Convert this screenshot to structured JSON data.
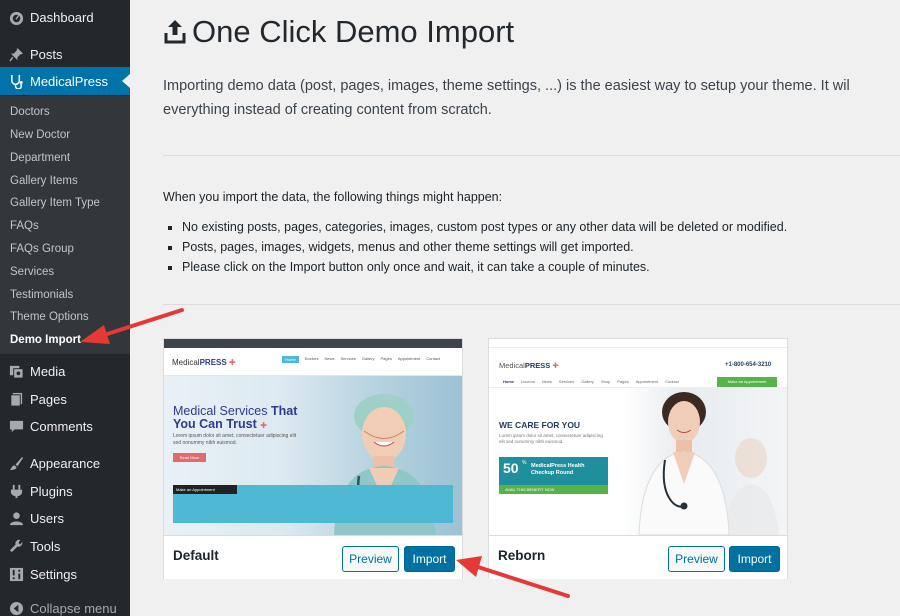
{
  "sidebar": {
    "top_items": [
      {
        "label": "Dashboard",
        "icon": "dashboard-icon"
      },
      {
        "label": "Posts",
        "icon": "pin-icon"
      },
      {
        "label": "MedicalPress",
        "icon": "stethoscope-icon"
      }
    ],
    "submenu": [
      "Doctors",
      "New Doctor",
      "Department",
      "Gallery Items",
      "Gallery Item Type",
      "FAQs",
      "FAQs Group",
      "Services",
      "Testimonials",
      "Theme Options",
      "Demo Import"
    ],
    "bottom_items": [
      {
        "label": "Media",
        "icon": "media-icon"
      },
      {
        "label": "Pages",
        "icon": "pages-icon"
      },
      {
        "label": "Comments",
        "icon": "comment-icon"
      },
      {
        "label": "Appearance",
        "icon": "brush-icon"
      },
      {
        "label": "Plugins",
        "icon": "plugin-icon"
      },
      {
        "label": "Users",
        "icon": "user-icon"
      },
      {
        "label": "Tools",
        "icon": "wrench-icon"
      },
      {
        "label": "Settings",
        "icon": "settings-icon"
      },
      {
        "label": "Collapse menu",
        "icon": "collapse-icon"
      }
    ]
  },
  "page": {
    "title": "One Click Demo Import",
    "intro_line1": "Importing demo data (post, pages, images, theme settings, ...) is the easiest way to setup your theme. It wil",
    "intro_line2": "everything instead of creating content from scratch.",
    "lead": "When you import the data, the following things might happen:",
    "bullets": [
      "No existing posts, pages, categories, images, custom post types or any other data will be deleted or modified.",
      "Posts, pages, images, widgets, menus and other theme settings will get imported.",
      "Please click on the Import button only once and wait, it can take a couple of minutes."
    ]
  },
  "demos": [
    {
      "name": "Default",
      "preview_label": "Preview",
      "import_label": "Import",
      "thumb": {
        "logo_plain": "Medical",
        "logo_bold": "PRESS",
        "headline_1": "Medical Services",
        "headline_2": "That",
        "headline_3": "You Can Trust",
        "subtext": "Lorem ipsum dolor sit amet, consectetuer adipiscing elit sed nonummy nibh euismod.",
        "read_more": "Read More",
        "form_title": "Make an Appointment",
        "nav": [
          "Home",
          "Doctors",
          "News",
          "Services",
          "Gallery",
          "Pages",
          "Appointment",
          "Contact"
        ]
      }
    },
    {
      "name": "Reborn",
      "preview_label": "Preview",
      "import_label": "Import",
      "thumb": {
        "logo_plain": "Medical",
        "logo_bold": "PRESS",
        "headline": "WE CARE FOR YOU",
        "subtext": "Lorem ipsum dolor sit amet, consectetuer adipiscing elit sed nonummy nibh euismod.",
        "promo_value": "50",
        "promo_text": "MedicalPress Health Checkup Round",
        "promo_cta": "AVAIL THIS BENEFIT NOW",
        "phone": "+1-800-654-3210",
        "appointment": "Make an Appointment",
        "nav": [
          "Home",
          "Doctors",
          "News",
          "Services",
          "Gallery",
          "Shop",
          "Pages",
          "Appointment",
          "Contact"
        ]
      }
    }
  ],
  "colors": {
    "sidebar_bg": "#23282d",
    "active_menu": "#0073aa",
    "primary_button": "#0071a1",
    "annotation_arrow": "#e53935"
  }
}
